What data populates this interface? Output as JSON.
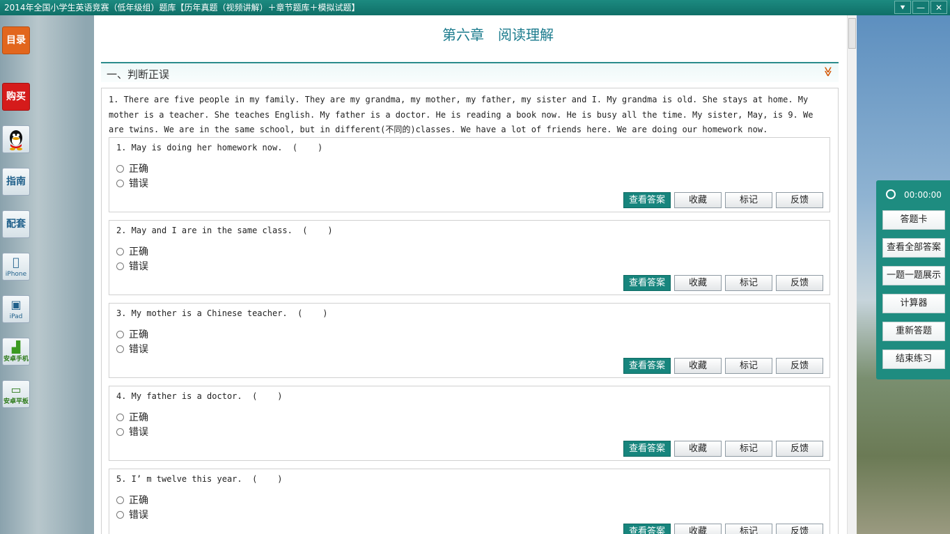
{
  "window": {
    "title": "2014年全国小学生英语竞赛（低年级组）题库【历年真题（视频讲解）＋章节题库＋模拟试题】",
    "buttons": [
      "⯆",
      "—",
      "✕"
    ]
  },
  "sidebar": {
    "items": [
      {
        "label": "目录"
      },
      {
        "label": "购买"
      },
      {
        "label": ""
      },
      {
        "label": "指南"
      },
      {
        "label": "配套"
      },
      {
        "label": "iPhone"
      },
      {
        "label": "iPad"
      },
      {
        "label": "安卓手机"
      },
      {
        "label": "安卓平板"
      }
    ]
  },
  "main": {
    "chapter_title": "第六章　阅读理解",
    "section_title": "一、判断正误",
    "section_toggle": "≫",
    "passage": "1. There are five people in my family. They are my grandma, my mother, my father, my sister and I. My grandma is old. She stays at home. My mother is a teacher. She teaches English. My father is a doctor. He is reading a book now. He is busy all the time. My sister, May, is 9. We are twins. We are in the same school, but in different(不同的)classes. We have a lot of friends here. We are doing our homework now.",
    "questions": [
      {
        "text": "1. May is doing her homework now.  (    )"
      },
      {
        "text": "2. May and I are in the same class.  (    )"
      },
      {
        "text": "3. My mother is a Chinese teacher.  (    )"
      },
      {
        "text": "4. My father is a doctor.  (    )"
      },
      {
        "text": "5. I’ m twelve this year.  (    )"
      }
    ],
    "options": {
      "true": "正确",
      "false": "错误"
    },
    "actions": {
      "show_answer": "查看答案",
      "favorite": "收藏",
      "mark": "标记",
      "feedback": "反馈"
    }
  },
  "right_panel": {
    "timer": "00:00:00",
    "buttons": [
      "答题卡",
      "查看全部答案",
      "一题一题展示",
      "计算器",
      "重新答题",
      "结束练习"
    ]
  }
}
